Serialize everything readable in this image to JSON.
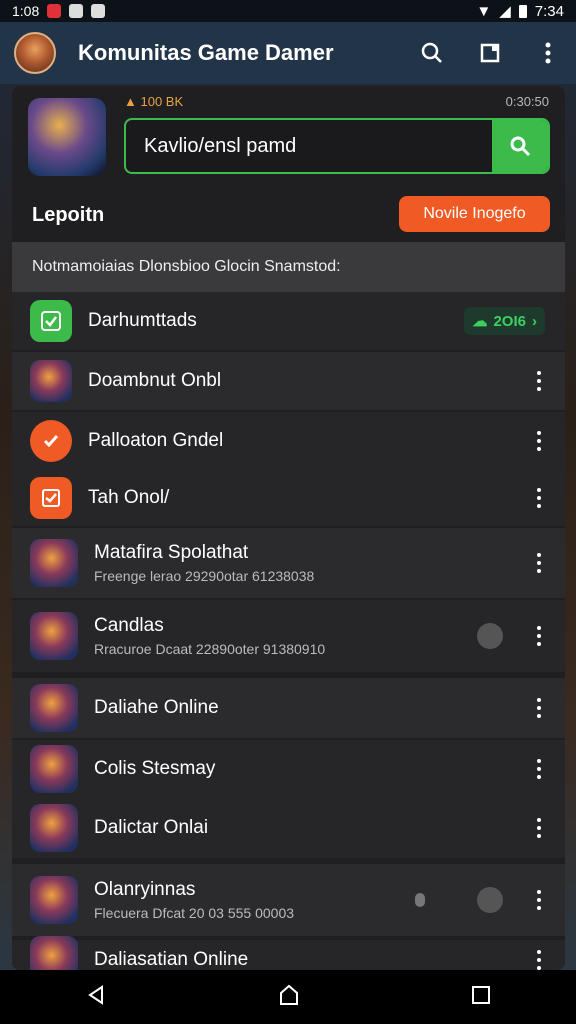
{
  "status": {
    "time_left": "1:08",
    "time_right": "7:34"
  },
  "appbar": {
    "title": "Komunitas Game Damer",
    "icons": [
      "search-icon",
      "square-icon",
      "more-vertical-icon"
    ]
  },
  "hero": {
    "meta_left": "100 BK",
    "meta_right": "0:30:50"
  },
  "search": {
    "value": "Kavlio/ensl pamd"
  },
  "section": {
    "label": "Lepoitn",
    "button": "Novile Inogefo"
  },
  "notice": "Notmamoiaias Dlonsbioo Glocin Snamstod:",
  "rows": [
    {
      "title": "Darhumttads",
      "badge": "2OI6",
      "icon": "check-square-icon",
      "color": "#3dbb4a"
    },
    {
      "title": "Doambnut Onbl",
      "icon": "game-art",
      "color": "#3a4a8a"
    },
    {
      "title": "Palloaton Gndel",
      "icon": "check-circle-icon",
      "color": "#f05a24"
    },
    {
      "title": "Tah Onol/",
      "icon": "check-square-icon",
      "color": "#f05a24"
    },
    {
      "title": "Matafira Spolathat",
      "subtitle": "Freenge lerao 29290otar 61238038",
      "icon": "game-art",
      "color": "#6a3a2a"
    },
    {
      "title": "Candlas",
      "subtitle": "Rracuroe Dcaat 22890oter 91380910",
      "icon": "game-art",
      "color": "#5a2a3a"
    },
    {
      "title": "Daliahe Online",
      "icon": "game-art",
      "color": "#3a6a9a"
    },
    {
      "title": "Colis Stesmay",
      "icon": "game-art",
      "color": "#1a3a5a"
    },
    {
      "title": "Dalictar Onlai",
      "icon": "game-art",
      "color": "#4a2a2a"
    },
    {
      "title": "Olanryinnas",
      "subtitle": "Flecuera Dfcat 20 03 555 00003",
      "icon": "game-art",
      "color": "#4a4a5a"
    },
    {
      "title": "Daliasatian Online",
      "icon": "game-art",
      "color": "#2a5a8a"
    }
  ],
  "colors": {
    "accent_green": "#3dbb4a",
    "accent_orange": "#f05a24",
    "appbar": "#223548"
  }
}
